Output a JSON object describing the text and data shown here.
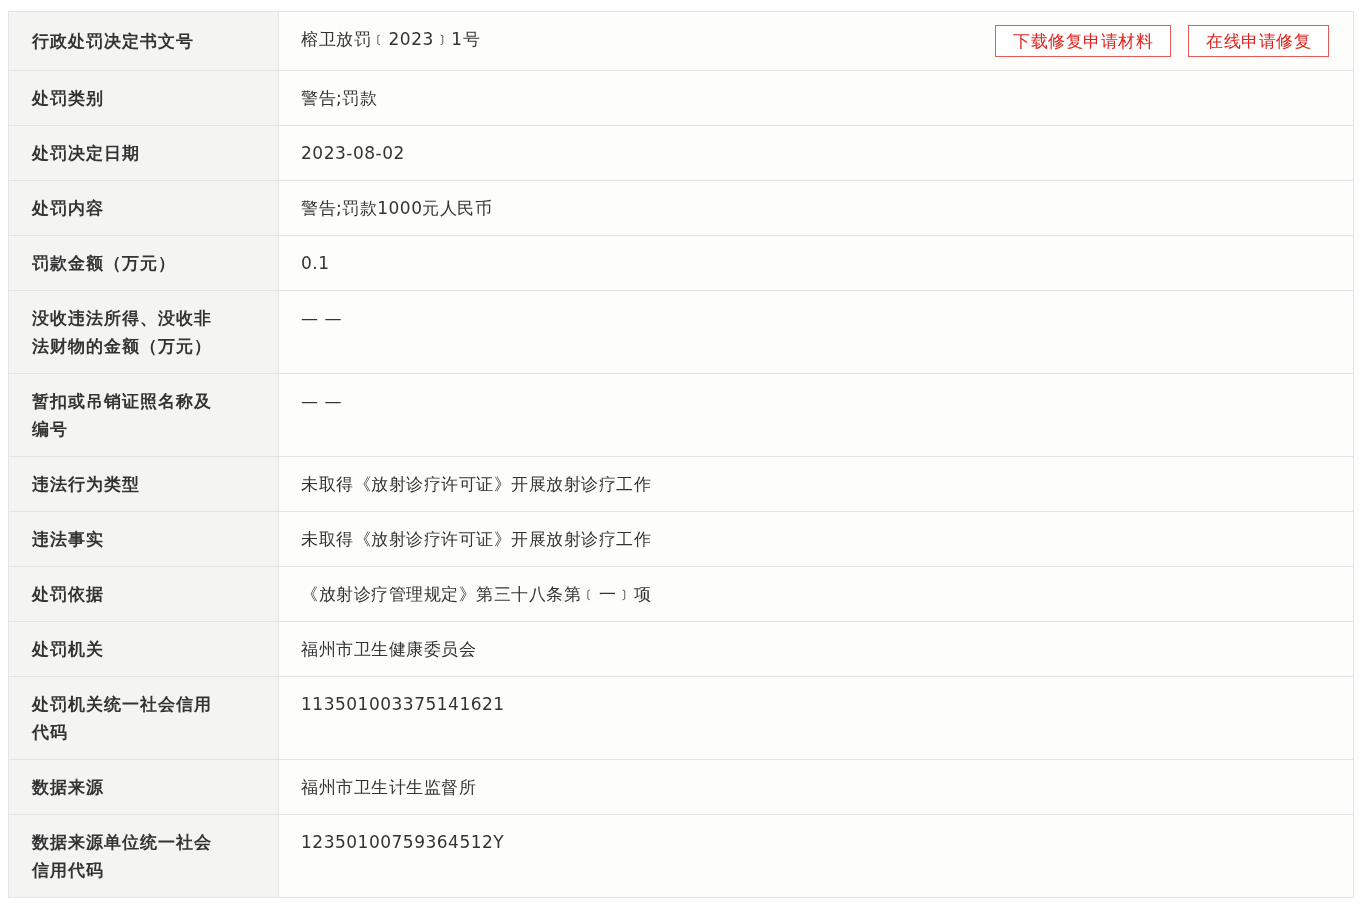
{
  "rows": [
    {
      "label": "行政处罚决定书文号",
      "value": "榕卫放罚﹝2023﹞1号",
      "buttons": [
        "下载修复申请材料",
        "在线申请修复"
      ]
    },
    {
      "label": "处罚类别",
      "value": "警告;罚款"
    },
    {
      "label": "处罚决定日期",
      "value": "2023-08-02"
    },
    {
      "label": "处罚内容",
      "value": "警告;罚款1000元人民币"
    },
    {
      "label": "罚款金额（万元）",
      "value": "0.1"
    },
    {
      "label": "没收违法所得、没收非法财物的金额（万元）",
      "value": "— —"
    },
    {
      "label": "暂扣或吊销证照名称及编号",
      "value": "— —"
    },
    {
      "label": "违法行为类型",
      "value": "未取得《放射诊疗许可证》开展放射诊疗工作"
    },
    {
      "label": "违法事实",
      "value": "未取得《放射诊疗许可证》开展放射诊疗工作"
    },
    {
      "label": "处罚依据",
      "value": "《放射诊疗管理规定》第三十八条第﹝一﹞项"
    },
    {
      "label": "处罚机关",
      "value": "福州市卫生健康委员会"
    },
    {
      "label": "处罚机关统一社会信用代码",
      "value": "113501003375141621"
    },
    {
      "label": "数据来源",
      "value": "福州市卫生计生监督所"
    },
    {
      "label": "数据来源单位统一社会信用代码",
      "value": "12350100759364512Y"
    }
  ]
}
